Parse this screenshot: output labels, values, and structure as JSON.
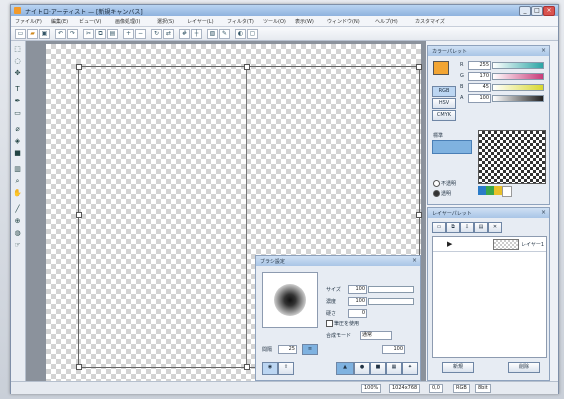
{
  "window": {
    "title": "ナイトロ·アーティスト — [新規キャンバス]"
  },
  "menu": [
    "ファイル(F)",
    "編集(E)",
    "ビュー(V)",
    "画像処理(I)",
    "選択(S)",
    "レイヤー(L)",
    "フィルタ(T)",
    "ツール(O)",
    "表示(W)",
    "ウィンドウ(N)",
    "ヘルプ(H)",
    "カスタマイズ"
  ],
  "color_panel": {
    "title": "カラーパレット",
    "fields": [
      {
        "label": "R",
        "value": "255"
      },
      {
        "label": "G",
        "value": "170"
      },
      {
        "label": "B",
        "value": "45"
      },
      {
        "label": "A",
        "value": "100"
      }
    ],
    "mode_labels": [
      "RGB",
      "HSV",
      "CMYK"
    ],
    "swatch_label": "標準",
    "opts": [
      {
        "label": "不透明"
      },
      {
        "label": "透明"
      }
    ],
    "foreground_color": "#f2a533",
    "background_color": "#ffffff"
  },
  "layer_panel": {
    "title": "レイヤーパレット",
    "layer_name": "レイヤー1",
    "buttons": [
      "新規",
      "削除"
    ]
  },
  "brush_panel": {
    "title": "ブラシ設定",
    "size_label": "サイズ",
    "size_value": "100",
    "opacity_label": "濃度",
    "opacity_value": "100",
    "hardness_label": "硬さ",
    "hardness_value": "0",
    "check_label": "筆圧を使用",
    "mode_label": "合成モード",
    "mode_value": "通常",
    "spacing_label": "間隔",
    "spacing_value": "25",
    "footer_value": "100"
  },
  "status": [
    "100%",
    "1024x768",
    "0,0",
    "RGB",
    "8bit"
  ]
}
